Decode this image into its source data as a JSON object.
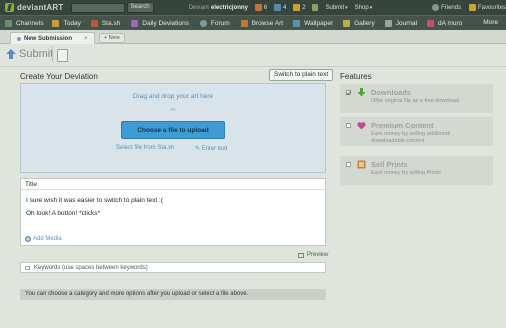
{
  "topbar": {
    "logo_main": "deviant",
    "logo_art": "ART",
    "search_button": "Search",
    "deviant_label": "Deviant",
    "username": "electricjonny",
    "count_a": "6",
    "count_b": "4",
    "count_c": "2",
    "submit": "Submit",
    "shop": "Shop",
    "friends": "Friends",
    "favourites": "Favourites"
  },
  "nav": {
    "items": [
      {
        "label": "Channels",
        "color": "#6f8f6a"
      },
      {
        "label": "Today",
        "color": "#c99d3a"
      },
      {
        "label": "Sta.sh",
        "color": "#b85a3a"
      },
      {
        "label": "Daily Deviations",
        "color": "#9a6bb0"
      },
      {
        "label": "Forum",
        "color": "#7f9a9a"
      },
      {
        "label": "Browse Art",
        "color": "#c0783a"
      },
      {
        "label": "Wallpaper",
        "color": "#5c8fb0"
      },
      {
        "label": "Gallery",
        "color": "#b6b046"
      },
      {
        "label": "Journal",
        "color": "#a0a0a0"
      },
      {
        "label": "dA muro",
        "color": "#c05070"
      }
    ],
    "more": "More"
  },
  "tabs": {
    "active": "New Submission",
    "close": "×",
    "new_tab": "+ New"
  },
  "submit_header": {
    "title": "Submit"
  },
  "create": {
    "title": "Create Your Deviation",
    "switch_plain": "Switch to plain text",
    "drag": "Drag and drop your art here",
    "or": "or",
    "choose": "Choose a file to upload",
    "sta_link": "Select file from Sta.sh",
    "enter_text": "Enter text",
    "editor_title": "Title",
    "line1": "I sure wish it was easier to switch to plain text :(",
    "line2": "Oh look!  A button!  *clicks*",
    "add_media": "Add Media",
    "preview": "Preview",
    "keywords_placeholder": "Keywords (use spaces between keywords)",
    "info": "You can choose a category and more options after you upload or select a file above."
  },
  "features": {
    "title": "Features",
    "items": [
      {
        "name": "Downloads",
        "desc": "Offer original file as a free download",
        "checked": true,
        "icon_color": "#5aa03a"
      },
      {
        "name": "Premium Content",
        "desc": "Earn money by selling additional downloadable content",
        "checked": false,
        "icon_color": "#c04a8a"
      },
      {
        "name": "Sell Prints",
        "desc": "Earn money by selling Prints",
        "checked": false,
        "icon_color": "#c0883a"
      }
    ]
  },
  "colors": {
    "topbar": "#35453c",
    "navbar": "#44544a",
    "background": "#dfe5dc",
    "upload_button": "#3e9bd4",
    "link": "#5f8fb3"
  }
}
